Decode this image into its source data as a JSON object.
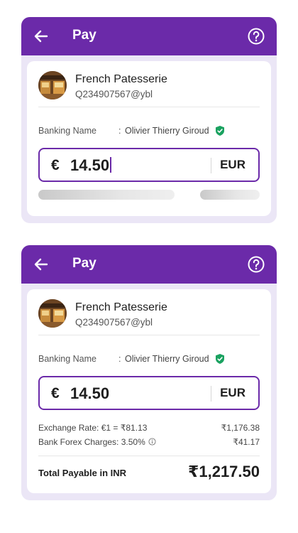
{
  "colors": {
    "brand": "#6b2aa9",
    "card_bg": "#ebe6f6",
    "verified": "#1aa260"
  },
  "screens": [
    {
      "header": {
        "title": "Pay",
        "back_icon": "arrow-left-icon",
        "help_icon": "help-circle-icon"
      },
      "merchant": {
        "name": "French Patesserie",
        "vpa": "Q234907567@ybl"
      },
      "banking": {
        "label": "Banking Name",
        "separator": ":",
        "name": "Olivier Thierry Giroud",
        "verified_icon": "verified-shield-icon"
      },
      "amount": {
        "symbol": "€",
        "value": "14.50",
        "currency": "EUR",
        "focused": true
      },
      "loading": true
    },
    {
      "header": {
        "title": "Pay",
        "back_icon": "arrow-left-icon",
        "help_icon": "help-circle-icon"
      },
      "merchant": {
        "name": "French Patesserie",
        "vpa": "Q234907567@ybl"
      },
      "banking": {
        "label": "Banking Name",
        "separator": ":",
        "name": "Olivier Thierry Giroud",
        "verified_icon": "verified-shield-icon"
      },
      "amount": {
        "symbol": "€",
        "value": "14.50",
        "currency": "EUR",
        "focused": false
      },
      "exchange": {
        "label": "Exchange Rate: €1 = ₹81.13",
        "value": "₹1,176.38"
      },
      "forex": {
        "label": "Bank Forex Charges: 3.50%",
        "value": "₹41.17",
        "icon": "info-icon"
      },
      "total": {
        "label": "Total Payable in INR",
        "value": "₹1,217.50"
      }
    }
  ]
}
